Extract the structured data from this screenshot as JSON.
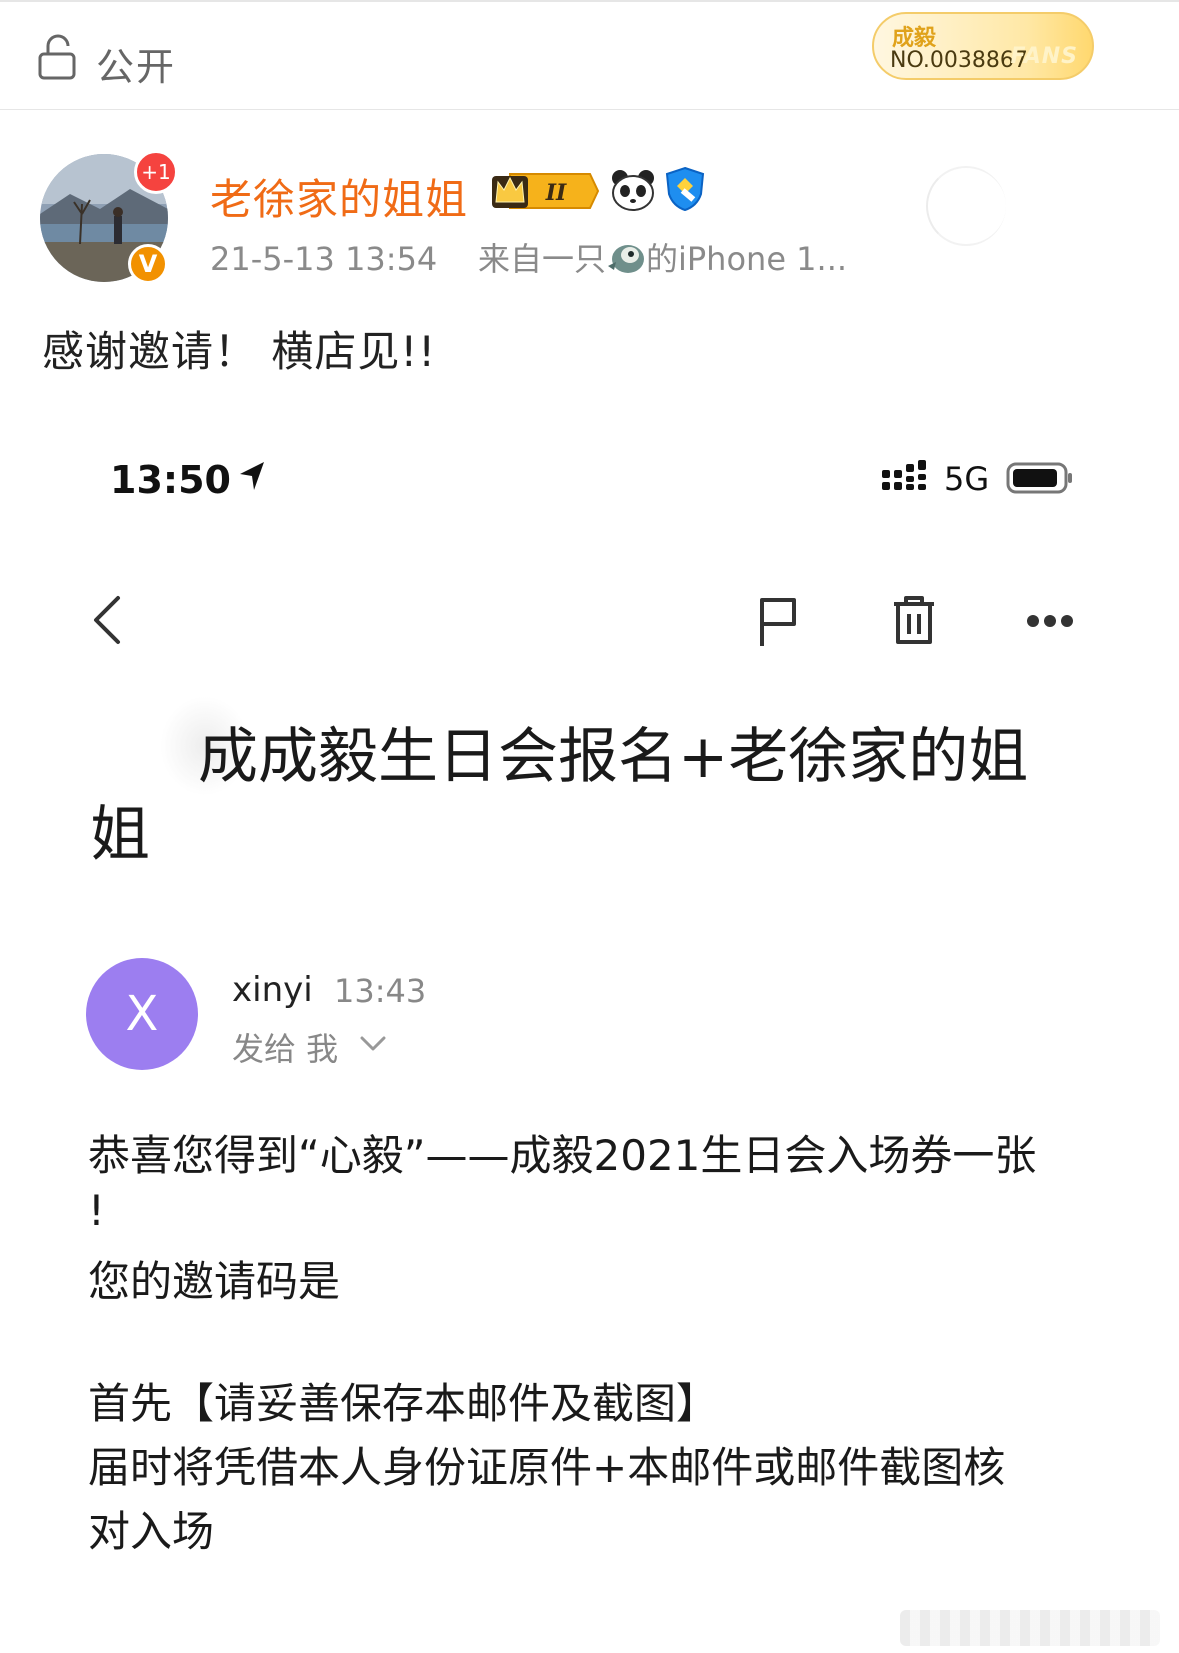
{
  "topbar": {
    "visibility_label": "公开",
    "fans_badge": {
      "name": "成毅",
      "number": "NO.0038867",
      "word": "FANS"
    }
  },
  "post": {
    "username": "老徐家的姐姐",
    "plus_badge": "+1",
    "verify_badge": "V",
    "crown_level": "II",
    "timestamp": "21-5-13 13:54",
    "source_prefix": "来自一只",
    "source_suffix": "的iPhone 1...",
    "text": "感谢邀请！ 横店见!!"
  },
  "screenshot": {
    "status_time": "13:50",
    "network": "5G",
    "subject_line1": "成成毅生日会报名+老徐家的姐",
    "subject_line2": "姐",
    "sender_initial": "X",
    "sender_name": "xinyi",
    "sender_time": "13:43",
    "recipient": "发给 我",
    "body": [
      "恭喜您得到“心毅”——成毅2021生日会入场券一张",
      "!",
      "您的邀请码是",
      "首先【请妥善保存本邮件及截图】",
      "届时将凭借本人身份证原件+本邮件或邮件截图核",
      "对入场"
    ]
  },
  "colors": {
    "username": "#f06b16",
    "sender_avatar": "#9c7ef0",
    "badge_red": "#f5433f",
    "verify_orange": "#f29100"
  },
  "icons": [
    "lock-icon",
    "crown-badge-icon",
    "panda-icon",
    "shield-icon",
    "bird-icon",
    "location-arrow-icon",
    "signal-icon",
    "battery-icon",
    "back-icon",
    "flag-icon",
    "trash-icon",
    "more-icon",
    "chevron-down-icon"
  ]
}
